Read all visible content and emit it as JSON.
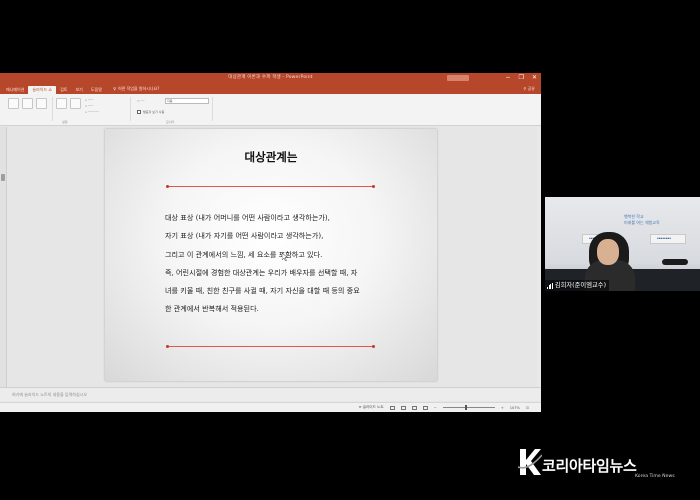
{
  "window": {
    "title": "대상관계 이론과 수퍼 학생 - PowerPoint",
    "controls": [
      "−",
      "❐",
      "✕"
    ]
  },
  "ribbon": {
    "tabs": [
      {
        "label": "애니메이션",
        "active": false
      },
      {
        "label": "슬라이드 쇼",
        "active": true
      },
      {
        "label": "검토",
        "active": false
      },
      {
        "label": "보기",
        "active": false
      },
      {
        "label": "도움말",
        "active": false
      }
    ],
    "tell_me": "어떤 작업을 원하시나요?",
    "share": "공유",
    "groups": [
      "설정",
      "모니터"
    ],
    "show_presenter_label": "발표자 보기 사용",
    "monitor_value": "자동"
  },
  "slide": {
    "title": "대상관계는",
    "body_lines": [
      "대상 표상 (내가 어머니를 어떤 사람이라고 생각하는가),",
      "자기 표상 (내가 자기를 어떤 사람이라고 생각하는가),",
      "그리고 이 관계에서의 느낌, 세 요소를 포함하고 있다.",
      "즉, 어린시절에 경험한 대상관계는 우리가 배우자를 선택할 때, 자",
      "녀를 키울 때, 친한 친구를 사귈 때, 자기 자신을 대할 때 등의 중요",
      "한 관계에서 반복해서 적용된다."
    ]
  },
  "notes": {
    "placeholder": "여기에 슬라이드 노트의 내용을 입력하십시오"
  },
  "statusbar": {
    "notes_label": "슬라이드 노트",
    "zoom": "107%"
  },
  "webcam": {
    "participant_name": "김희자(준이엠교수)",
    "wall_slogan_lines": [
      "행복한 학교",
      "미래를 여는 체험교육"
    ]
  },
  "watermark": {
    "logo_letter": "K",
    "name": "코리아타임뉴스",
    "subtitle": "Korea Time News"
  },
  "colors": {
    "ppt_accent": "#b7472a",
    "slide_rule": "#e0574d"
  }
}
